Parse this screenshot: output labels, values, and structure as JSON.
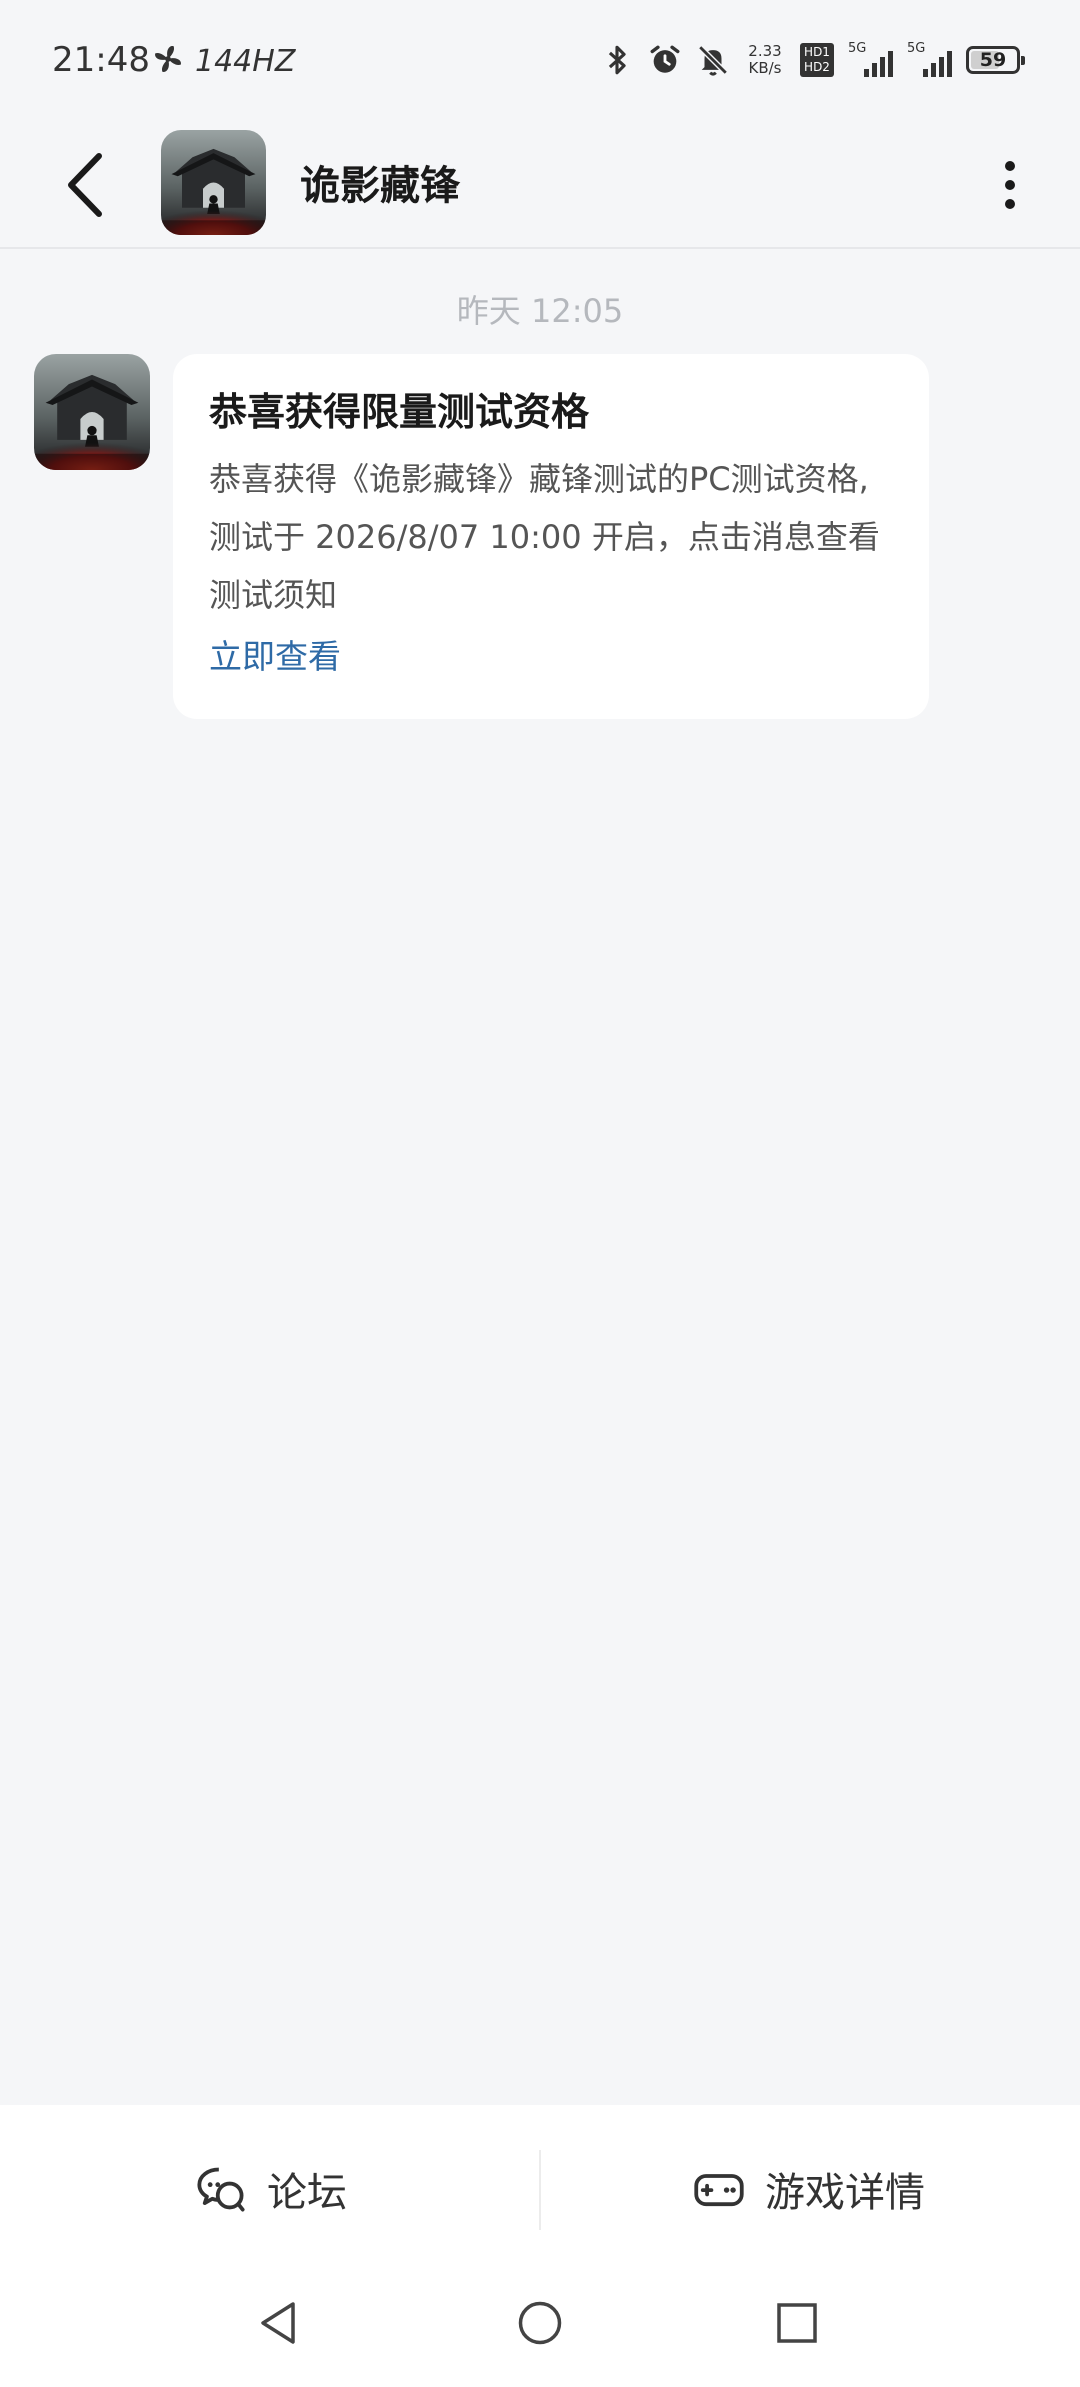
{
  "status_bar": {
    "time": "21:48",
    "refresh_rate": "144HZ",
    "net_rate_value": "2.33",
    "net_rate_unit": "KB/s",
    "hd_badge": "HD1\nHD2",
    "sim1_label": "5G",
    "sim2_label": "5G",
    "battery": "59",
    "battery_level": 0.59
  },
  "header": {
    "title": "诡影藏锋"
  },
  "conversation": {
    "timestamp": "昨天  12:05",
    "message": {
      "title": "恭喜获得限量测试资格",
      "body": "恭喜获得《诡影藏锋》藏锋测试的PC测试资格,测试于 2026/8/07 10:00 开启，点击消息查看测试须知",
      "link": "立即查看"
    }
  },
  "bottom_tabs": {
    "forum": "论坛",
    "game_details": "游戏详情"
  },
  "colors": {
    "background": "#f5f6f8",
    "card": "#ffffff",
    "link": "#2e6aa6",
    "timestamp": "#b5b8bd"
  },
  "icons": [
    "fan-icon",
    "bluetooth-icon",
    "alarm-icon",
    "mute-bell-icon",
    "signal-icon",
    "battery-icon",
    "back-arrow-icon",
    "more-vertical-icon",
    "forum-chat-icon",
    "gamepad-icon",
    "nav-back-icon",
    "nav-home-icon",
    "nav-recents-icon"
  ]
}
